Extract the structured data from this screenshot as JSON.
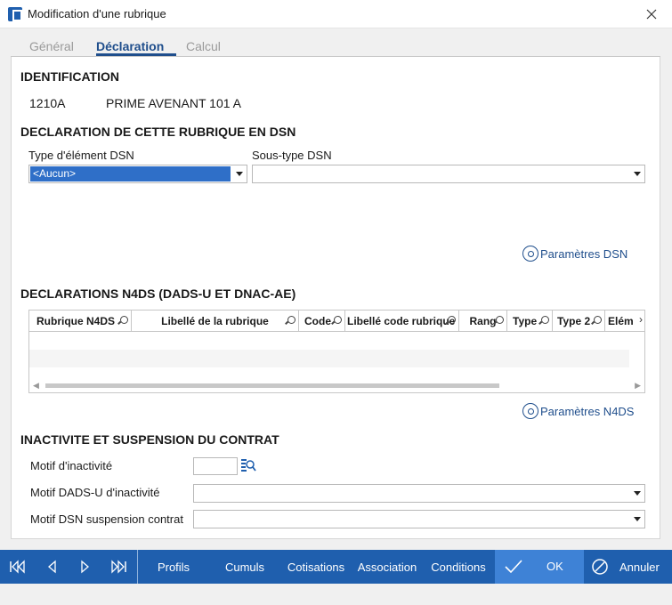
{
  "window": {
    "title": "Modification d'une rubrique"
  },
  "tabs": [
    {
      "label": "Général"
    },
    {
      "label": "Déclaration"
    },
    {
      "label": "Calcul"
    }
  ],
  "identification": {
    "title": "IDENTIFICATION",
    "code": "1210A",
    "label": "PRIME AVENANT 101 A"
  },
  "dsn": {
    "title": "DECLARATION DE CETTE RUBRIQUE EN DSN",
    "type_label": "Type d'élément DSN",
    "type_value": "<Aucun>",
    "subtype_label": "Sous-type DSN",
    "subtype_value": "",
    "params_button": "Paramètres DSN"
  },
  "n4ds": {
    "title": "DECLARATIONS N4DS (DADS-U ET DNAC-AE)",
    "columns": [
      "Rubrique N4DS",
      "Libellé de la rubrique",
      "Code",
      "Libellé code rubrique",
      "Rang",
      "Type",
      "Type 2",
      "Elém"
    ],
    "params_button": "Paramètres N4DS"
  },
  "inactivity": {
    "title": "INACTIVITE ET SUSPENSION DU CONTRAT",
    "motif_label": "Motif d'inactivité",
    "motif_value": "",
    "dadsu_label": "Motif DADS-U d'inactivité",
    "dadsu_value": "",
    "dsn_suspension_label": "Motif DSN suspension contrat",
    "dsn_suspension_value": ""
  },
  "footer": {
    "profils": "Profils",
    "cumuls": "Cumuls",
    "cotisations": "Cotisations",
    "association": "Association",
    "conditions": "Conditions",
    "ok": "OK",
    "annuler": "Annuler"
  },
  "colors": {
    "accent": "#1f5fae",
    "tab_active": "#1f4e8c",
    "selection": "#2f6fc8"
  }
}
